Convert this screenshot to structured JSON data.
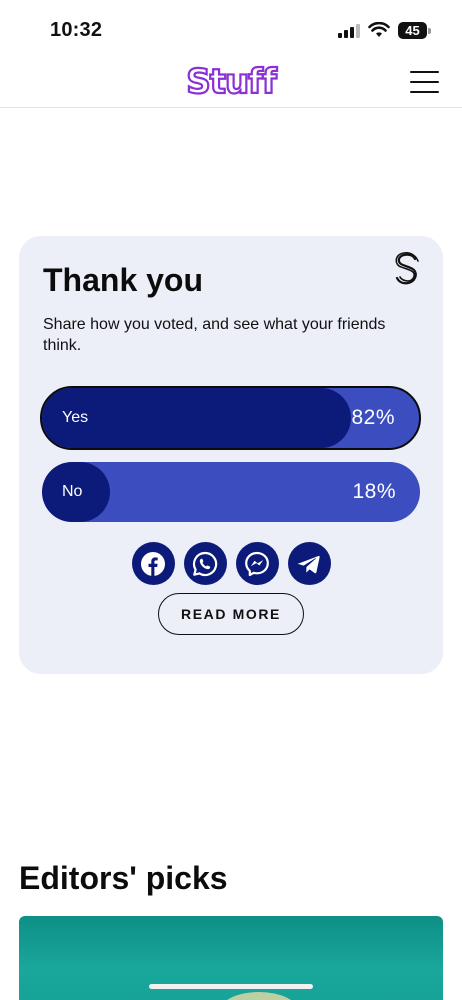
{
  "status_bar": {
    "time": "10:32",
    "battery": "45"
  },
  "header": {
    "logo": "Stuff",
    "menu_icon": "hamburger-menu-icon"
  },
  "poll": {
    "title": "Thank you",
    "subtitle": "Share how you voted, and see what your friends think.",
    "options": [
      {
        "label": "Yes",
        "percent_text": "82%",
        "percent": 82,
        "selected": true
      },
      {
        "label": "No",
        "percent_text": "18%",
        "percent": 18,
        "selected": false
      }
    ],
    "share_icons": [
      "facebook-icon",
      "whatsapp-icon",
      "messenger-icon",
      "telegram-icon"
    ],
    "read_more_label": "READ MORE"
  },
  "editors_picks": {
    "title": "Editors' picks"
  },
  "colors": {
    "brand_purple": "#8b2fd6",
    "card_bg": "#eceef8",
    "option_bg": "#3c4ebf",
    "option_fill": "#0c1a79"
  }
}
